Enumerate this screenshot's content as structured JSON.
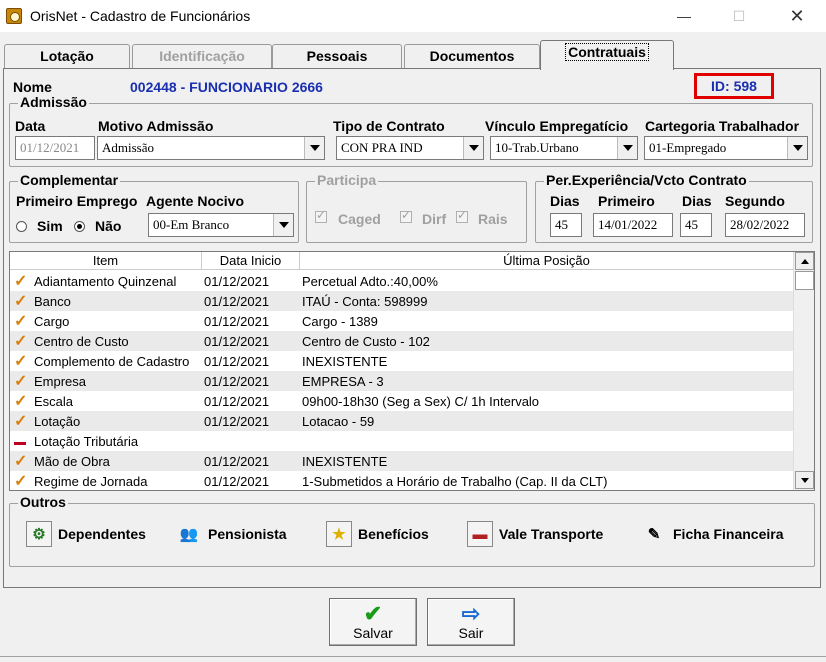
{
  "window": {
    "title": "OrisNet - Cadastro de Funcionários",
    "minimize": "—",
    "maximize": "☐",
    "close": "✕"
  },
  "tabs": [
    {
      "label": "Lotação",
      "state": "normal"
    },
    {
      "label": "Identificação",
      "state": "disabled"
    },
    {
      "label": "Pessoais",
      "state": "normal"
    },
    {
      "label": "Documentos",
      "state": "normal"
    },
    {
      "label": "Contratuais",
      "state": "active"
    }
  ],
  "header": {
    "nome_label": "Nome",
    "nome_value": "002448 - FUNCIONARIO 2666",
    "id_value": "ID: 598",
    "id_highlight_color": "#e00000"
  },
  "admissao": {
    "title": "Admissão",
    "data_label": "Data",
    "data_value": "01/12/2021",
    "motivo_label": "Motivo Admissão",
    "motivo_value": "Admissão",
    "tipo_label": "Tipo de Contrato",
    "tipo_value": "CON PRA IND",
    "vinculo_label": "Vínculo Empregatício",
    "vinculo_value": "10-Trab.Urbano",
    "categoria_label": "Cartegoria Trabalhador",
    "categoria_value": "01-Empregado"
  },
  "complementar": {
    "title": "Complementar",
    "primeiro_label": "Primeiro Emprego",
    "sim": "Sim",
    "nao": "Não",
    "selected": "Não",
    "agente_label": "Agente Nocivo",
    "agente_value": "00-Em Branco"
  },
  "participa": {
    "title": "Participa",
    "caged": "Caged",
    "dirf": "Dirf",
    "rais": "Rais"
  },
  "experiencia": {
    "title": "Per.Experiência/Vcto Contrato",
    "dias1_label": "Dias",
    "primeiro_label": "Primeiro",
    "dias2_label": "Dias",
    "segundo_label": "Segundo",
    "dias1": "45",
    "primeiro": "14/01/2022",
    "dias2": "45",
    "segundo": "28/02/2022"
  },
  "grid": {
    "headers": [
      "Item",
      "Data Inicio",
      "Última Posição"
    ],
    "rows": [
      {
        "icon": "check-icon",
        "item": "Adiantamento Quinzenal",
        "data": "01/12/2021",
        "pos": "Percetual Adto.:40,00%"
      },
      {
        "icon": "check-icon",
        "item": "Banco",
        "data": "01/12/2021",
        "pos": "ITAÚ - Conta: 598999"
      },
      {
        "icon": "check-icon",
        "item": "Cargo",
        "data": "01/12/2021",
        "pos": "Cargo - 1389"
      },
      {
        "icon": "check-icon",
        "item": "Centro de Custo",
        "data": "01/12/2021",
        "pos": "Centro de Custo - 102"
      },
      {
        "icon": "check-icon",
        "item": "Complemento de Cadastro",
        "data": "01/12/2021",
        "pos": "INEXISTENTE"
      },
      {
        "icon": "check-icon",
        "item": "Empresa",
        "data": "01/12/2021",
        "pos": "EMPRESA - 3"
      },
      {
        "icon": "check-icon",
        "item": "Escala",
        "data": "01/12/2021",
        "pos": "09h00-18h30 (Seg a Sex) C/ 1h Intervalo"
      },
      {
        "icon": "check-icon",
        "item": "Lotação",
        "data": "01/12/2021",
        "pos": "Lotacao - 59"
      },
      {
        "icon": "dash-icon",
        "item": "Lotação Tributária",
        "data": "",
        "pos": ""
      },
      {
        "icon": "check-icon",
        "item": "Mão de Obra",
        "data": "01/12/2021",
        "pos": "INEXISTENTE"
      },
      {
        "icon": "check-icon",
        "item": "Regime de Jornada",
        "data": "01/12/2021",
        "pos": "1-Submetidos a Horário de Trabalho (Cap. II da CLT)"
      }
    ]
  },
  "outros": {
    "title": "Outros",
    "buttons": [
      {
        "label": "Dependentes",
        "icon": "dependents-icon"
      },
      {
        "label": "Pensionista",
        "icon": "pensioner-icon"
      },
      {
        "label": "Benefícios",
        "icon": "star-icon"
      },
      {
        "label": "Vale Transporte",
        "icon": "bus-icon"
      },
      {
        "label": "Ficha Financeira",
        "icon": "financial-icon"
      }
    ]
  },
  "footer": {
    "salvar": "Salvar",
    "sair": "Sair"
  }
}
